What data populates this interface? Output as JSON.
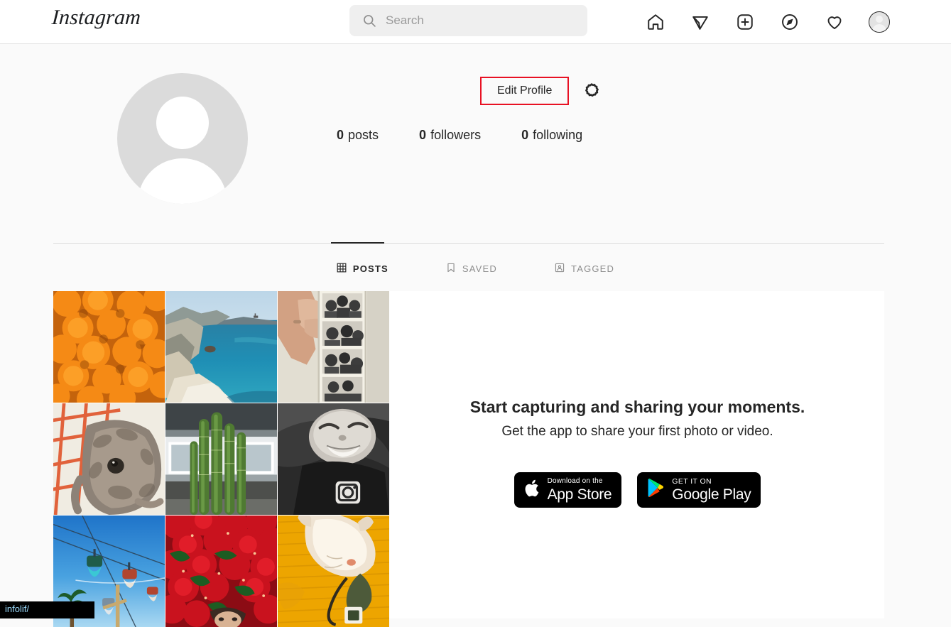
{
  "header": {
    "brand": "Instagram",
    "search": {
      "placeholder": "Search",
      "value": "",
      "icon": "search-icon"
    },
    "nav": [
      {
        "name": "home-icon",
        "label": "Home"
      },
      {
        "name": "direct-message-icon",
        "label": "Messages"
      },
      {
        "name": "new-post-icon",
        "label": "New Post"
      },
      {
        "name": "explore-compass-icon",
        "label": "Explore"
      },
      {
        "name": "activity-heart-icon",
        "label": "Activity"
      },
      {
        "name": "profile-avatar-icon",
        "label": "Profile"
      }
    ]
  },
  "profile": {
    "avatar_name": "default-profile-avatar",
    "edit_profile_label": "Edit Profile",
    "settings_icon": "gear-icon",
    "highlight_color": "#e81123",
    "stats": [
      {
        "count": "0",
        "label": "posts"
      },
      {
        "count": "0",
        "label": "followers"
      },
      {
        "count": "0",
        "label": "following"
      }
    ]
  },
  "tabs": [
    {
      "label": "POSTS",
      "icon": "grid-icon",
      "active": true
    },
    {
      "label": "SAVED",
      "icon": "bookmark-icon",
      "active": false
    },
    {
      "label": "TAGGED",
      "icon": "person-tag-icon",
      "active": false
    }
  ],
  "content": {
    "cta_title": "Start capturing and sharing your moments.",
    "cta_subtitle": "Get the app to share your first photo or video.",
    "badges": [
      {
        "name": "app-store-badge",
        "small": "Download on the",
        "big": "App Store",
        "icon": "apple-logo-icon"
      },
      {
        "name": "google-play-badge",
        "small": "GET IT ON",
        "big": "Google Play",
        "icon": "google-play-logo-icon"
      }
    ],
    "photo_grid": [
      {
        "alt": "oranges-photo"
      },
      {
        "alt": "coastal-cliff-beach-photo"
      },
      {
        "alt": "photobooth-strip-photo"
      },
      {
        "alt": "dog-on-striped-blanket-photo"
      },
      {
        "alt": "cactus-by-building-photo"
      },
      {
        "alt": "smiling-baby-bw-photo"
      },
      {
        "alt": "sky-ride-gondolas-photo"
      },
      {
        "alt": "red-bougainvillea-flowers-photo"
      },
      {
        "alt": "cat-on-yellow-blanket-photo"
      }
    ]
  },
  "status_tip": {
    "text": "infolif/"
  }
}
